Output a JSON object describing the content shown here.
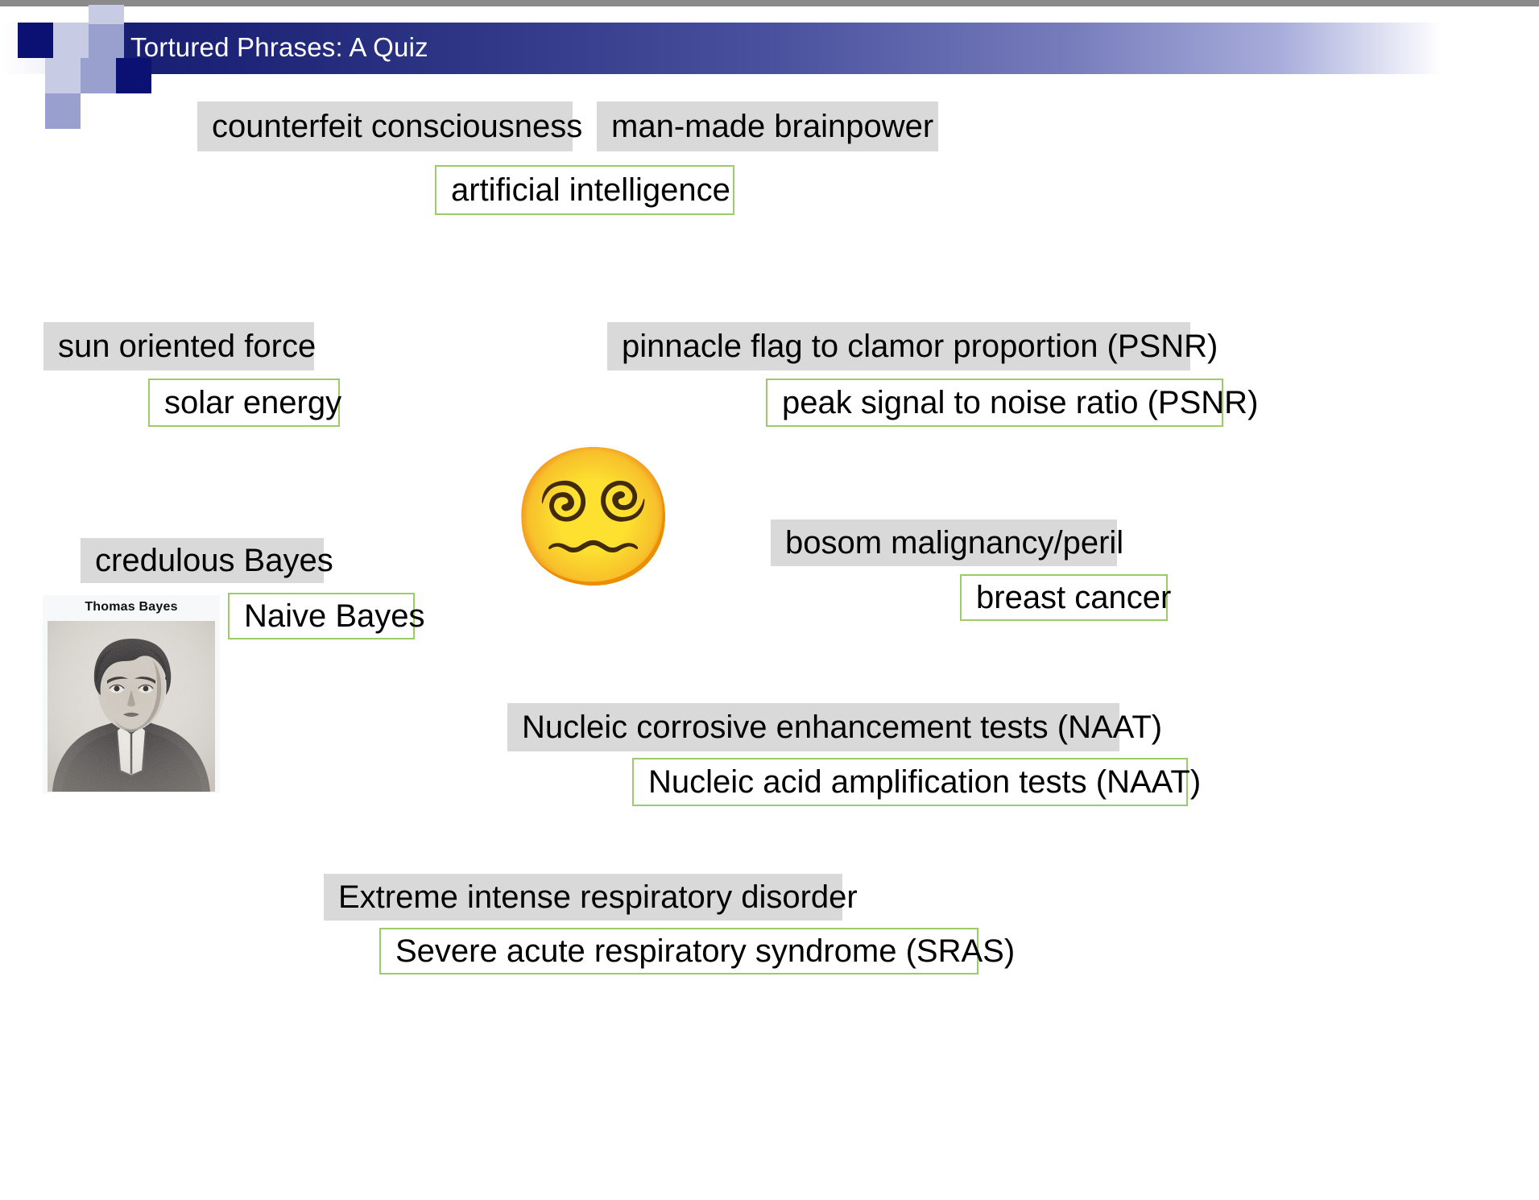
{
  "slide": {
    "title": "Tortured Phrases: A Quiz",
    "banner_accent": "#171d72",
    "tortured_bg": "#d9d9d9",
    "correct_border": "#9ccc65"
  },
  "pairs": [
    {
      "id": "ai",
      "tortured": "counterfeit consciousness",
      "tortured_alt": "man-made brainpower",
      "correct": "artificial intelligence"
    },
    {
      "id": "solar",
      "tortured": "sun oriented force",
      "correct": "solar energy"
    },
    {
      "id": "psnr",
      "tortured": "pinnacle flag to clamor proportion (PSNR)",
      "correct": "peak signal to noise ratio (PSNR)"
    },
    {
      "id": "bayes",
      "tortured": "credulous Bayes",
      "correct": "Naive Bayes"
    },
    {
      "id": "cancer",
      "tortured": "bosom malignancy/peril",
      "correct": "breast cancer"
    },
    {
      "id": "naat",
      "tortured": "Nucleic corrosive enhancement tests (NAAT)",
      "correct": "Nucleic acid amplification tests (NAAT)"
    },
    {
      "id": "sras",
      "tortured": "Extreme intense respiratory disorder",
      "correct": "Severe acute respiratory syndrome (SRAS)"
    }
  ],
  "media": {
    "emoji": "😵‍💫",
    "emoji_name": "face-with-spiral-eyes",
    "bayes_caption": "Thomas Bayes"
  }
}
